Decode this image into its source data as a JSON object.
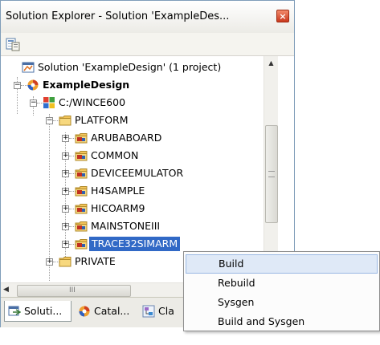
{
  "window": {
    "title": "Solution Explorer - Solution 'ExampleDes...",
    "close_glyph": "×"
  },
  "toolbar": {
    "properties_icon": "properties-icon"
  },
  "tree": {
    "solution": "Solution 'ExampleDesign' (1 project)",
    "project": "ExampleDesign",
    "wince": "C:/WINCE600",
    "platform": "PLATFORM",
    "platform_children": [
      "ARUBABOARD",
      "COMMON",
      "DEVICEEMULATOR",
      "H4SAMPLE",
      "HICOARM9",
      "MAINSTONEIII",
      "TRACE32SIMARM"
    ],
    "private": "PRIVATE",
    "expand_glyph": "+",
    "collapse_glyph": "−"
  },
  "hscroll": {
    "left_arrow": "◀",
    "grip": "III"
  },
  "vscroll": {
    "up_arrow": "▲"
  },
  "tabs": [
    {
      "label": "Soluti...",
      "icon": "solution-explorer-icon",
      "active": true
    },
    {
      "label": "Catal...",
      "icon": "catalog-icon",
      "active": false
    },
    {
      "label": "Cla",
      "icon": "class-view-icon",
      "active": false
    }
  ],
  "context_menu": {
    "items": [
      "Build",
      "Rebuild",
      "Sysgen",
      "Build and Sysgen"
    ],
    "highlighted": "Build"
  },
  "colors": {
    "selection": "#3169c6",
    "menu_highlight": "#dfe9f7",
    "folder": "#f2c45a"
  }
}
